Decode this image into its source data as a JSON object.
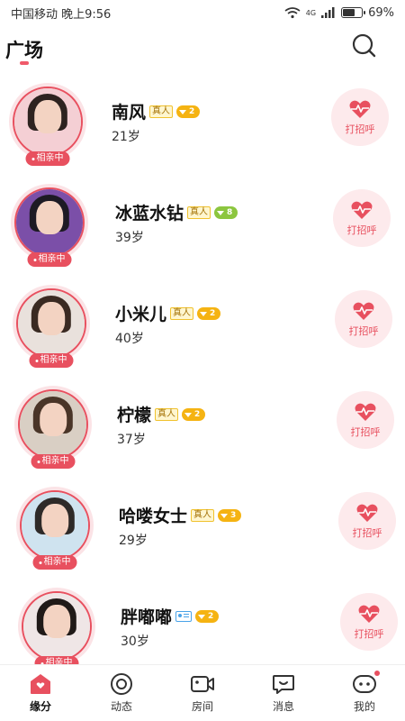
{
  "status_bar": {
    "carrier_time": "中国移动 晚上9:56",
    "network_type": "4G",
    "battery_percent": "69%",
    "battery_level": 0.69
  },
  "header": {
    "title": "广场",
    "search_icon": "search-icon"
  },
  "users": [
    {
      "name": "南风",
      "age": "21岁",
      "verify": "真人",
      "verify_type": "real",
      "level": "2",
      "level_color": "#f5b312",
      "dating": "相亲中",
      "greet": "打招呼",
      "avatar_bg": "#f4cfd4",
      "hair": "#2e2320"
    },
    {
      "name": "冰蓝水钻",
      "age": "39岁",
      "verify": "真人",
      "verify_type": "real",
      "level": "8",
      "level_color": "#8cc63f",
      "dating": "相亲中",
      "greet": "打招呼",
      "avatar_bg": "#7b4fa8",
      "hair": "#1d1a24"
    },
    {
      "name": "小米儿",
      "age": "40岁",
      "verify": "真人",
      "verify_type": "real",
      "level": "2",
      "level_color": "#f5b312",
      "dating": "相亲中",
      "greet": "打招呼",
      "avatar_bg": "#e9e1dc",
      "hair": "#3a2a22"
    },
    {
      "name": "柠檬",
      "age": "37岁",
      "verify": "真人",
      "verify_type": "real",
      "level": "2",
      "level_color": "#f5b312",
      "dating": "相亲中",
      "greet": "打招呼",
      "avatar_bg": "#d9cfc4",
      "hair": "#4a3528"
    },
    {
      "name": "哈喽女士",
      "age": "29岁",
      "verify": "真人",
      "verify_type": "real",
      "level": "3",
      "level_color": "#f5b312",
      "dating": "相亲中",
      "greet": "打招呼",
      "avatar_bg": "#cfe3ef",
      "hair": "#2e2a28"
    },
    {
      "name": "胖嘟嘟",
      "age": "30岁",
      "verify": "",
      "verify_type": "id",
      "level": "2",
      "level_color": "#f5b312",
      "dating": "相亲中",
      "greet": "打招呼",
      "avatar_bg": "#efe6e6",
      "hair": "#201a18"
    }
  ],
  "nav": [
    {
      "label": "缘分",
      "icon": "heart-home-icon",
      "active": true
    },
    {
      "label": "动态",
      "icon": "moments-icon",
      "active": false
    },
    {
      "label": "房间",
      "icon": "video-room-icon",
      "active": false
    },
    {
      "label": "消息",
      "icon": "message-icon",
      "active": false
    },
    {
      "label": "我的",
      "icon": "profile-face-icon",
      "active": false
    }
  ],
  "colors": {
    "accent": "#e8505f",
    "accent_light": "#fdeaec"
  }
}
